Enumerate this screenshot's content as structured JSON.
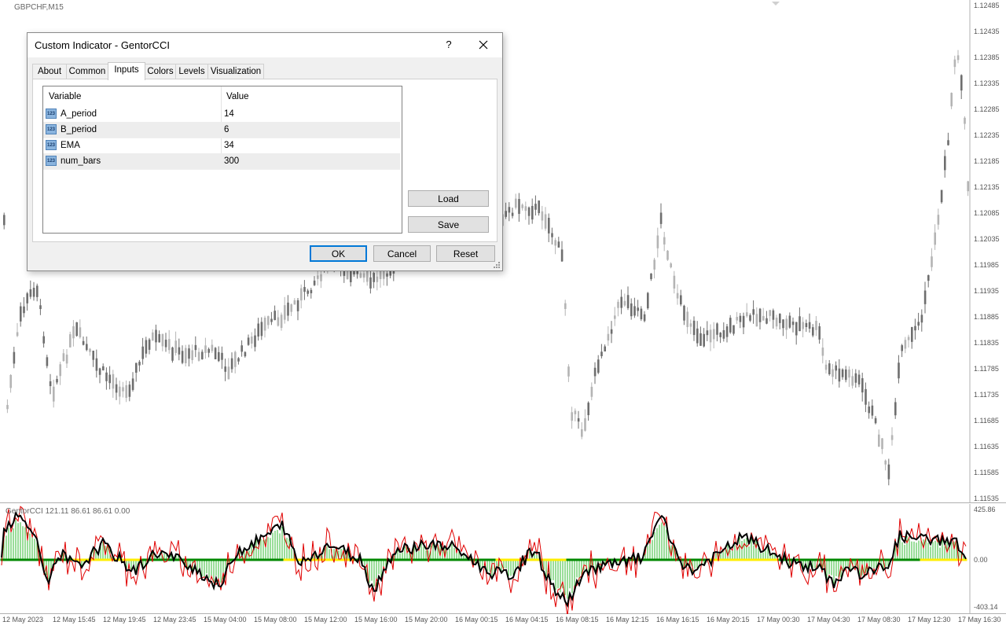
{
  "chart": {
    "symbol_label": "GBPCHF,M15",
    "price_ticks": [
      "1.12485",
      "1.12435",
      "1.12385",
      "1.12335",
      "1.12285",
      "1.12235",
      "1.12185",
      "1.12135",
      "1.12085",
      "1.12035",
      "1.11985",
      "1.11935",
      "1.11885",
      "1.11835",
      "1.11785",
      "1.11735",
      "1.11685",
      "1.11635",
      "1.11585",
      "1.11535"
    ],
    "indicator_label": "GentorCCI 121.11 86.61 86.61 0.00",
    "indicator_ticks": [
      "425.86",
      "0.00",
      "-403.14"
    ],
    "time_ticks": [
      "12 May 2023",
      "12 May 15:45",
      "12 May 19:45",
      "12 May 23:45",
      "15 May 04:00",
      "15 May 08:00",
      "15 May 12:00",
      "15 May 16:00",
      "15 May 20:00",
      "16 May 00:15",
      "16 May 04:15",
      "16 May 08:15",
      "16 May 12:15",
      "16 May 16:15",
      "16 May 20:15",
      "17 May 00:30",
      "17 May 04:30",
      "17 May 08:30",
      "17 May 12:30",
      "17 May 16:30"
    ],
    "colors": {
      "up_candle": "#b4b4b4",
      "down_candle": "#6e6e6e",
      "histogram_pos": "#33bb33",
      "histogram_neg": "#33bb33",
      "cci_line": "#000000",
      "signal_line": "#e00000",
      "zero_green": "#008800",
      "zero_yellow": "#ffee00"
    }
  },
  "dialog": {
    "title": "Custom Indicator - GentorCCI",
    "help_label": "?",
    "tabs": [
      {
        "label": "About"
      },
      {
        "label": "Common"
      },
      {
        "label": "Inputs",
        "active": true
      },
      {
        "label": "Colors"
      },
      {
        "label": "Levels"
      },
      {
        "label": "Visualization"
      }
    ],
    "grid": {
      "col_variable": "Variable",
      "col_value": "Value",
      "icon_text": "123",
      "rows": [
        {
          "variable": "A_period",
          "value": "14"
        },
        {
          "variable": "B_period",
          "value": "6"
        },
        {
          "variable": "EMA",
          "value": "34"
        },
        {
          "variable": "num_bars",
          "value": "300"
        }
      ]
    },
    "load_label": "Load",
    "save_label": "Save",
    "ok_label": "OK",
    "cancel_label": "Cancel",
    "reset_label": "Reset"
  }
}
